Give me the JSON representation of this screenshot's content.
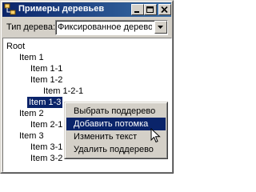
{
  "window": {
    "title": "Примеры деревьев",
    "controls": {
      "minimize": "minimize-icon",
      "maximize": "maximize-icon",
      "close": "close-icon"
    }
  },
  "toolbar": {
    "type_label": "Тип дерева:",
    "type_value": "Фиксированное дерево"
  },
  "tree": {
    "nodes": [
      {
        "label": "Root",
        "selected": false
      },
      {
        "label": "Item 1",
        "selected": false
      },
      {
        "label": "Item 1-1",
        "selected": false
      },
      {
        "label": "Item 1-2",
        "selected": false
      },
      {
        "label": "Item 1-2-1",
        "selected": false
      },
      {
        "label": "Item 1-3",
        "selected": true
      },
      {
        "label": "Item 2",
        "selected": false
      },
      {
        "label": "Item 2-1",
        "selected": false
      },
      {
        "label": "Item 3",
        "selected": false
      },
      {
        "label": "Item 3-1",
        "selected": false
      },
      {
        "label": "Item 3-2",
        "selected": false
      }
    ]
  },
  "context_menu": {
    "items": [
      {
        "label": "Выбрать поддерево",
        "highlighted": false
      },
      {
        "label": "Добавить потомка",
        "highlighted": true
      },
      {
        "label": "Изменить текст",
        "highlighted": false
      },
      {
        "label": "Удалить поддерево",
        "highlighted": false
      }
    ]
  },
  "colors": {
    "title_start": "#0a246a",
    "title_end": "#3a6ea5",
    "selection": "#0a246a",
    "face": "#d4d0c8"
  }
}
